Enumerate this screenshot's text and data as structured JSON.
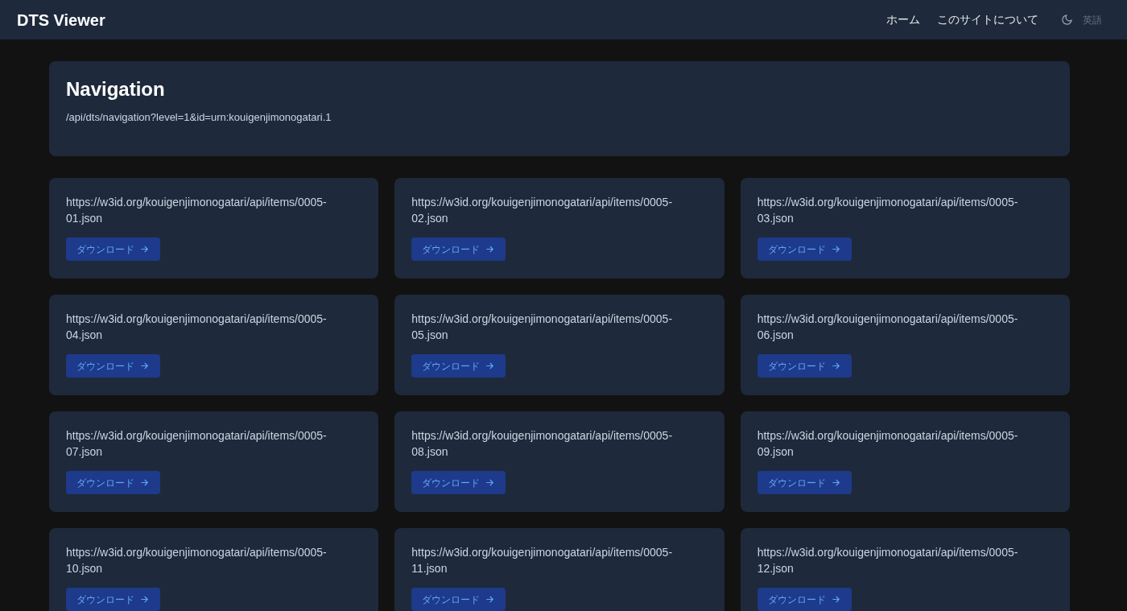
{
  "header": {
    "title": "DTS Viewer",
    "nav": [
      "ホーム",
      "このサイトについて"
    ],
    "language": "英語"
  },
  "navigation_card": {
    "title": "Navigation",
    "path": "/api/dts/navigation?level=1&id=urn:kouigenjimonogatari.1"
  },
  "items": [
    {
      "url": "https://w3id.org/kouigenjimonogatari/api/items/0005-01.json",
      "button": "ダウンロード"
    },
    {
      "url": "https://w3id.org/kouigenjimonogatari/api/items/0005-02.json",
      "button": "ダウンロード"
    },
    {
      "url": "https://w3id.org/kouigenjimonogatari/api/items/0005-03.json",
      "button": "ダウンロード"
    },
    {
      "url": "https://w3id.org/kouigenjimonogatari/api/items/0005-04.json",
      "button": "ダウンロード"
    },
    {
      "url": "https://w3id.org/kouigenjimonogatari/api/items/0005-05.json",
      "button": "ダウンロード"
    },
    {
      "url": "https://w3id.org/kouigenjimonogatari/api/items/0005-06.json",
      "button": "ダウンロード"
    },
    {
      "url": "https://w3id.org/kouigenjimonogatari/api/items/0005-07.json",
      "button": "ダウンロード"
    },
    {
      "url": "https://w3id.org/kouigenjimonogatari/api/items/0005-08.json",
      "button": "ダウンロード"
    },
    {
      "url": "https://w3id.org/kouigenjimonogatari/api/items/0005-09.json",
      "button": "ダウンロード"
    },
    {
      "url": "https://w3id.org/kouigenjimonogatari/api/items/0005-10.json",
      "button": "ダウンロード"
    },
    {
      "url": "https://w3id.org/kouigenjimonogatari/api/items/0005-11.json",
      "button": "ダウンロード"
    },
    {
      "url": "https://w3id.org/kouigenjimonogatari/api/items/0005-12.json",
      "button": "ダウンロード"
    }
  ]
}
